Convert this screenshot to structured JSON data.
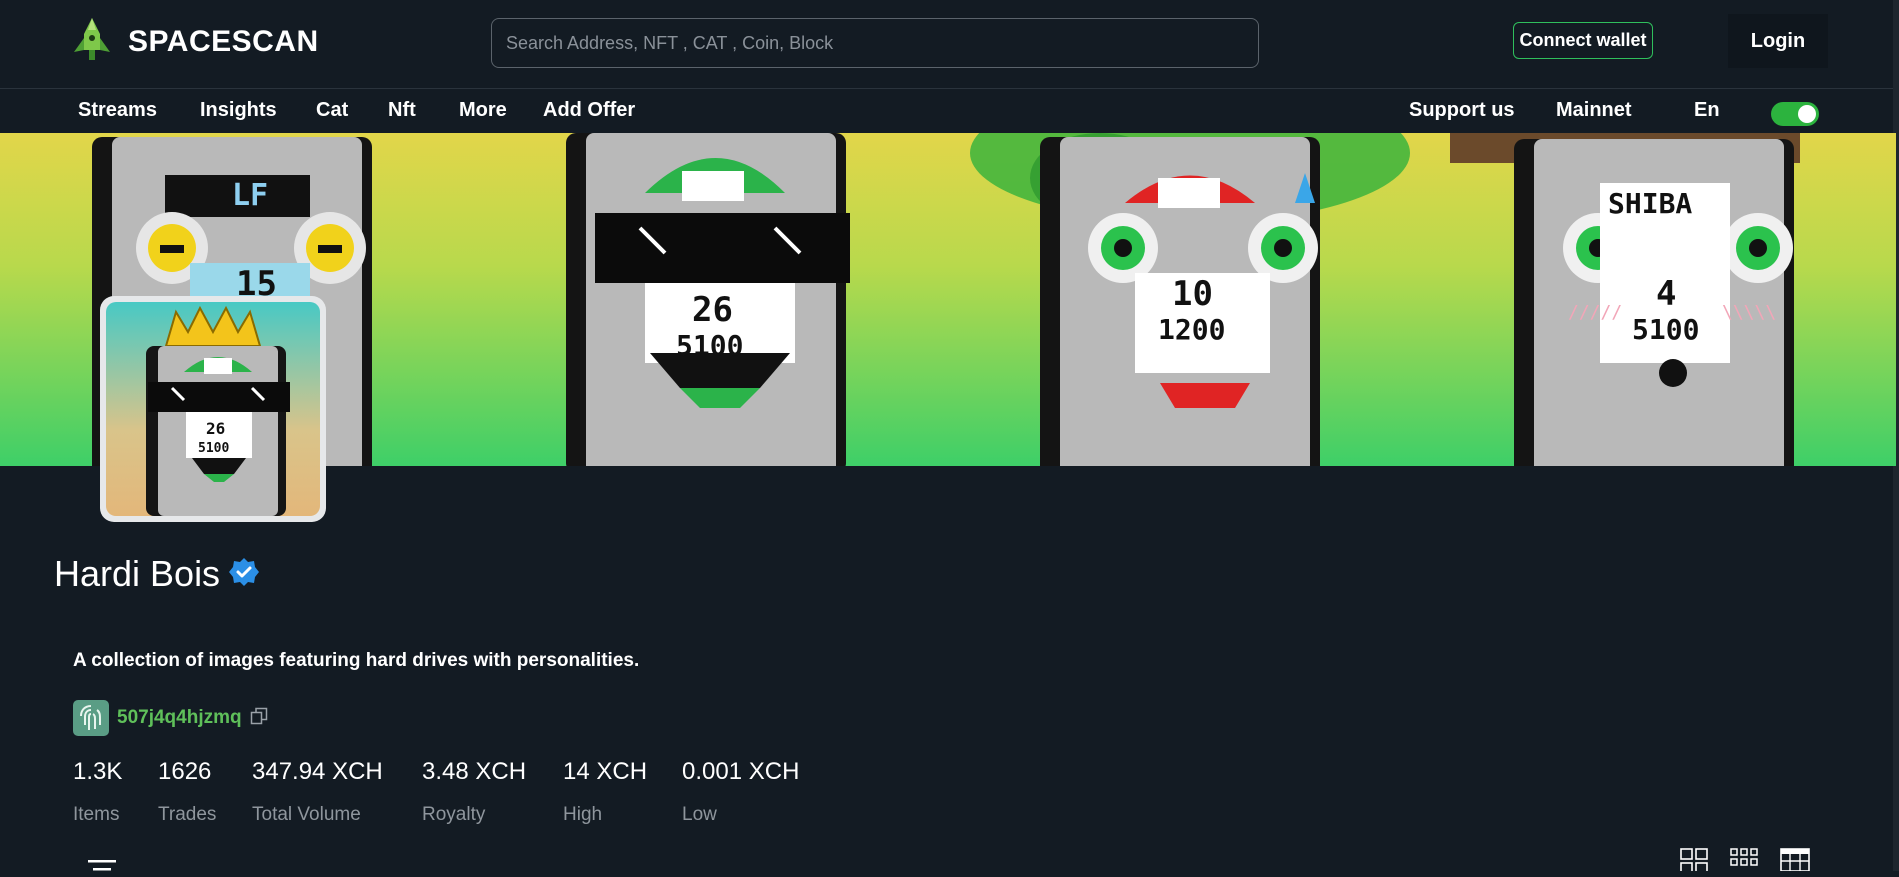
{
  "header": {
    "brand": "SPACESCAN",
    "search_placeholder": "Search Address, NFT , CAT , Coin, Block",
    "connect_label": "Connect wallet",
    "login_label": "Login"
  },
  "nav": {
    "left": [
      "Streams",
      "Insights",
      "Cat",
      "Nft",
      "More",
      "Add Offer"
    ],
    "support": "Support us",
    "network": "Mainnet",
    "language": "En"
  },
  "theme_toggle_on": true,
  "collection": {
    "name": "Hardi Bois",
    "verified": true,
    "description": "A collection of images featuring hard drives with personalities.",
    "owner": "507j4q4hjzmq"
  },
  "banner_labels": [
    {
      "top": "LF",
      "bottom": "15"
    },
    {
      "top": "26",
      "bottom": "5100"
    },
    {
      "top": "10",
      "bottom": "1200"
    },
    {
      "top": "SHIBA",
      "bottom": "4"
    },
    {
      "top": "",
      "bottom": "5100"
    }
  ],
  "avatar_labels": {
    "top": "26",
    "bottom": "5100"
  },
  "stats": [
    {
      "value": "1.3K",
      "label": "Items"
    },
    {
      "value": "1626",
      "label": "Trades"
    },
    {
      "value": "347.94 XCH",
      "label": "Total Volume"
    },
    {
      "value": "3.48 XCH",
      "label": "Royalty"
    },
    {
      "value": "14 XCH",
      "label": "High"
    },
    {
      "value": "0.001 XCH",
      "label": "Low"
    }
  ],
  "colors": {
    "background": "#131b23",
    "accent_green": "#2fbf5c",
    "owner_green": "#5fc05a",
    "verified_blue": "#2b8fe6"
  },
  "icons": [
    "rocket-logo-icon",
    "verified-badge-icon",
    "fingerprint-icon",
    "copy-icon",
    "filter-icon",
    "grid-large-icon",
    "grid-small-icon",
    "table-view-icon"
  ]
}
